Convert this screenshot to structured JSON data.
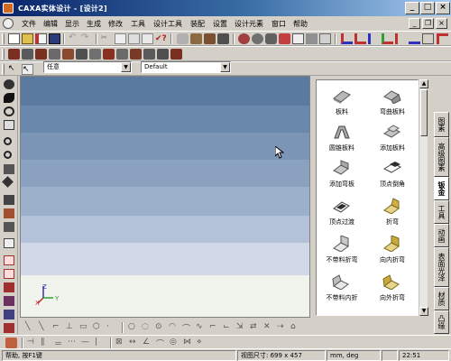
{
  "window": {
    "title": "CAXA实体设计 - [设计2]",
    "controls": [
      "_",
      "□",
      "×"
    ],
    "mdi_controls": [
      "_",
      "❐",
      "×"
    ]
  },
  "menu": [
    "文件",
    "编辑",
    "显示",
    "生成",
    "修改",
    "工具",
    "设计工具",
    "装配",
    "设置",
    "设计元素",
    "窗口",
    "帮助"
  ],
  "combos": {
    "filter": "任意",
    "style": "Default"
  },
  "library": {
    "items": [
      {
        "label": "板料",
        "icon": "flat-sheet-icon"
      },
      {
        "label": "弯曲板料",
        "icon": "bent-sheet-icon"
      },
      {
        "label": "圆锥板料",
        "icon": "cone-sheet-icon"
      },
      {
        "label": "添加板料",
        "icon": "add-sheet-icon"
      },
      {
        "label": "添加弯板",
        "icon": "add-bend-icon"
      },
      {
        "label": "顶点倒角",
        "icon": "vertex-chamfer-icon"
      },
      {
        "label": "顶点过渡",
        "icon": "vertex-round-icon"
      },
      {
        "label": "折弯",
        "icon": "fold-icon"
      },
      {
        "label": "不带料折弯",
        "icon": "bend-no-material-icon"
      },
      {
        "label": "向内折弯",
        "icon": "bend-inward-icon"
      },
      {
        "label": "不带料内折",
        "icon": "inner-fold-no-material-icon"
      },
      {
        "label": "向外折弯",
        "icon": "bend-outward-icon"
      }
    ]
  },
  "side_tabs": [
    {
      "label": "图素",
      "active": false
    },
    {
      "label": "高级图素",
      "active": false
    },
    {
      "label": "钣金",
      "active": true
    },
    {
      "label": "工具",
      "active": false
    },
    {
      "label": "动画",
      "active": false
    },
    {
      "label": "表面光泽",
      "active": false
    },
    {
      "label": "材质",
      "active": false
    },
    {
      "label": "凸缘",
      "active": false
    }
  ],
  "axis": {
    "x": "X",
    "y": "Y",
    "z": "Z"
  },
  "status": {
    "help": "帮助, 按F1键",
    "view_size": "视图尺寸: 699 x 457",
    "units": "mm, deg",
    "time": "22:51"
  },
  "colors": {
    "titlebar_start": "#0a246a",
    "viewport_band_top": "#5a7aa0",
    "viewport_band_bottom": "#dfe3ef"
  }
}
